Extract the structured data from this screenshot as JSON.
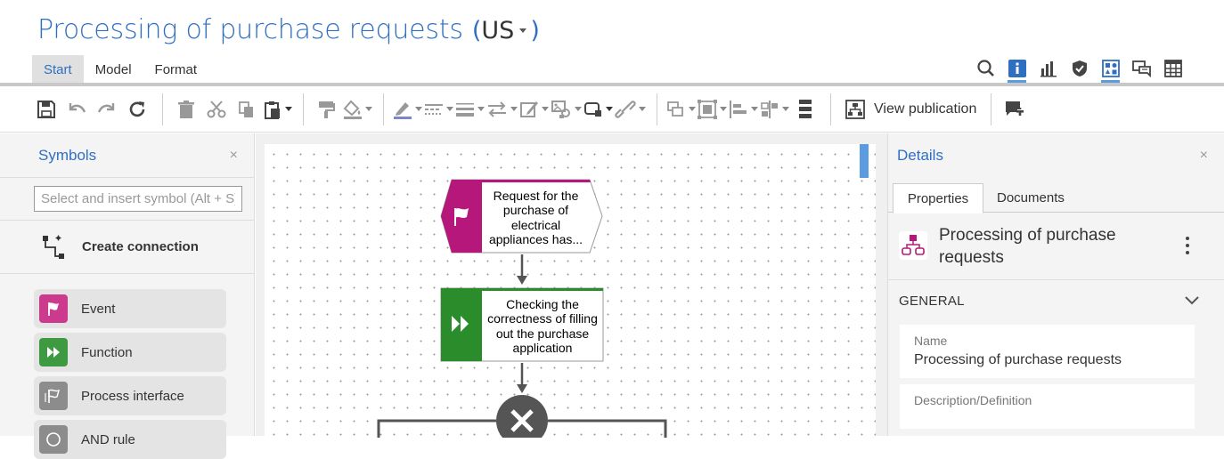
{
  "header": {
    "title": "Processing of purchase requests",
    "language": "US",
    "tabs": [
      {
        "label": "Start",
        "active": true
      },
      {
        "label": "Model",
        "active": false
      },
      {
        "label": "Format",
        "active": false
      }
    ]
  },
  "toolbar": {
    "view_publication": "View publication"
  },
  "symbols_panel": {
    "title": "Symbols",
    "close": "×",
    "search_placeholder": "Select and insert symbol (Alt + S)",
    "create_connection": "Create connection",
    "items": [
      {
        "label": "Event",
        "color": "#cc3a8e"
      },
      {
        "label": "Function",
        "color": "#3d9a41"
      },
      {
        "label": "Process interface",
        "color": "#8c8c8c"
      },
      {
        "label": "AND rule",
        "color": "#8c8c8c"
      }
    ]
  },
  "diagram": {
    "event_text": "Request for the purchase of electrical appliances has...",
    "function_text": "Checking the correctness of filling out the purchase application",
    "event_color": "#b5187a",
    "function_color": "#2a8c2a"
  },
  "details_panel": {
    "title": "Details",
    "close": "×",
    "tabs": [
      {
        "label": "Properties",
        "active": true
      },
      {
        "label": "Documents",
        "active": false
      }
    ],
    "object_name": "Processing of purchase requests",
    "section": "GENERAL",
    "fields": [
      {
        "label": "Name",
        "value": "Processing of purchase requests"
      },
      {
        "label": "Description/Definition",
        "value": ""
      }
    ]
  },
  "colors": {
    "accent": "#2f6fc2",
    "highlight": "#5b9be0"
  }
}
